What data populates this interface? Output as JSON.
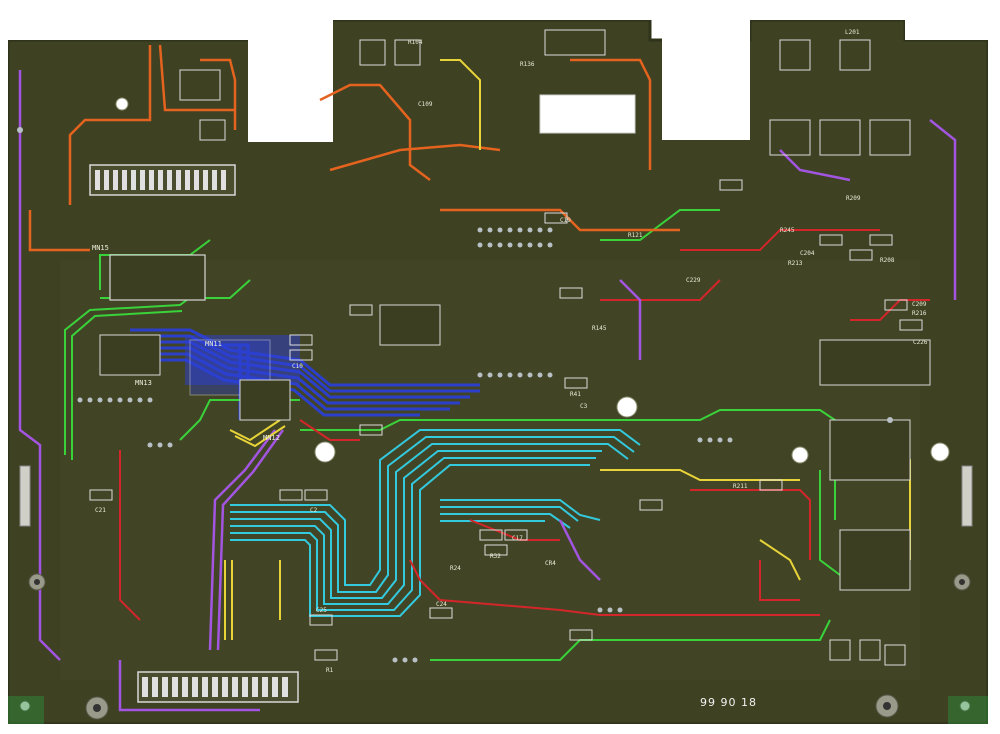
{
  "board": {
    "date_code": "99 90 18",
    "designators": [
      "MN11",
      "MN15",
      "MN13",
      "MN12",
      "C21",
      "C2",
      "C25",
      "R1",
      "R32",
      "C17",
      "R41",
      "C3",
      "CR4",
      "C24",
      "R24",
      "C10",
      "C19",
      "C109",
      "R245",
      "R213",
      "C204",
      "C229",
      "R208",
      "L201",
      "C209",
      "R216",
      "R211",
      "R209",
      "C226",
      "R145",
      "R121",
      "R136",
      "R104"
    ]
  },
  "colors": {
    "substrate": "#3e4122",
    "board_edge": "#2f3319",
    "silkscreen": "#e8ecd8",
    "bus_blue": "#2b3fd4",
    "trace_cyan": "#33c9de",
    "trace_green": "#3ad23a",
    "trace_orange": "#e4631f",
    "trace_red": "#d3262a",
    "trace_purple": "#a255e0",
    "trace_yellow": "#e8d438"
  }
}
